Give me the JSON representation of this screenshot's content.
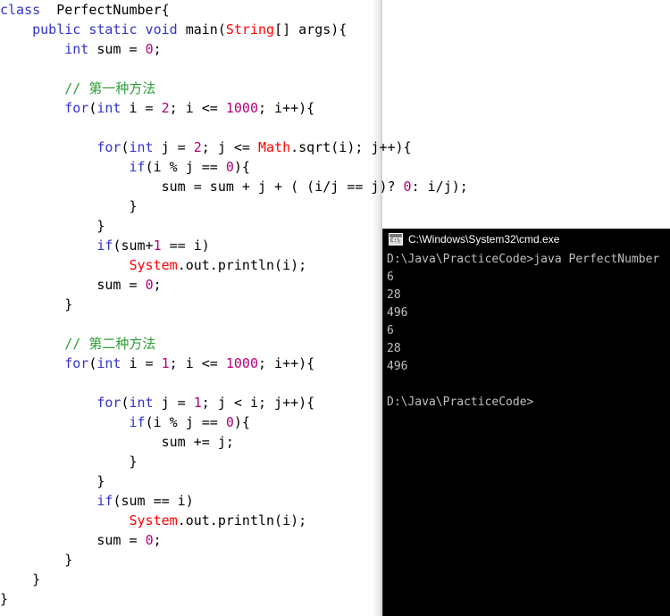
{
  "editor": {
    "name": "java-source-editor",
    "language": "Java",
    "colors": {
      "background": "#ffffff",
      "keyword": "#3333cc",
      "type": "#ff0000",
      "number": "#b3007a",
      "comment": "#2e9e37",
      "plain": "#000000"
    },
    "lines": [
      [
        {
          "t": "class ",
          "c": "kw"
        },
        {
          "t": " PerfectNumber{",
          "c": "pln"
        }
      ],
      [
        {
          "t": "    ",
          "c": "pln"
        },
        {
          "t": "public static void ",
          "c": "kw"
        },
        {
          "t": "main(",
          "c": "pln"
        },
        {
          "t": "String",
          "c": "type"
        },
        {
          "t": "[] args){",
          "c": "pln"
        }
      ],
      [
        {
          "t": "        ",
          "c": "pln"
        },
        {
          "t": "int ",
          "c": "kw"
        },
        {
          "t": "sum = ",
          "c": "pln"
        },
        {
          "t": "0",
          "c": "num"
        },
        {
          "t": ";",
          "c": "pln"
        }
      ],
      [],
      [
        {
          "t": "        ",
          "c": "pln"
        },
        {
          "t": "// 第一种方法",
          "c": "cmt"
        }
      ],
      [
        {
          "t": "        ",
          "c": "pln"
        },
        {
          "t": "for",
          "c": "kw"
        },
        {
          "t": "(",
          "c": "pln"
        },
        {
          "t": "int ",
          "c": "kw"
        },
        {
          "t": "i = ",
          "c": "pln"
        },
        {
          "t": "2",
          "c": "num"
        },
        {
          "t": "; i <= ",
          "c": "pln"
        },
        {
          "t": "1000",
          "c": "num"
        },
        {
          "t": "; i++){",
          "c": "pln"
        }
      ],
      [],
      [
        {
          "t": "            ",
          "c": "pln"
        },
        {
          "t": "for",
          "c": "kw"
        },
        {
          "t": "(",
          "c": "pln"
        },
        {
          "t": "int ",
          "c": "kw"
        },
        {
          "t": "j = ",
          "c": "pln"
        },
        {
          "t": "2",
          "c": "num"
        },
        {
          "t": "; j <= ",
          "c": "pln"
        },
        {
          "t": "Math",
          "c": "type"
        },
        {
          "t": ".sqrt(i); j++){",
          "c": "pln"
        }
      ],
      [
        {
          "t": "                ",
          "c": "pln"
        },
        {
          "t": "if",
          "c": "kw"
        },
        {
          "t": "(i % j == ",
          "c": "pln"
        },
        {
          "t": "0",
          "c": "num"
        },
        {
          "t": "){",
          "c": "pln"
        }
      ],
      [
        {
          "t": "                    sum = sum + j + ( (i/j == j)? ",
          "c": "pln"
        },
        {
          "t": "0",
          "c": "num"
        },
        {
          "t": ": i/j);",
          "c": "pln"
        }
      ],
      [
        {
          "t": "                }",
          "c": "pln"
        }
      ],
      [
        {
          "t": "            }",
          "c": "pln"
        }
      ],
      [
        {
          "t": "            ",
          "c": "pln"
        },
        {
          "t": "if",
          "c": "kw"
        },
        {
          "t": "(sum+",
          "c": "pln"
        },
        {
          "t": "1",
          "c": "num"
        },
        {
          "t": " == i)",
          "c": "pln"
        }
      ],
      [
        {
          "t": "                ",
          "c": "pln"
        },
        {
          "t": "System",
          "c": "type"
        },
        {
          "t": ".out.println(i);",
          "c": "pln"
        }
      ],
      [
        {
          "t": "            sum = ",
          "c": "pln"
        },
        {
          "t": "0",
          "c": "num"
        },
        {
          "t": ";",
          "c": "pln"
        }
      ],
      [
        {
          "t": "        }",
          "c": "pln"
        }
      ],
      [],
      [
        {
          "t": "        ",
          "c": "pln"
        },
        {
          "t": "// 第二种方法",
          "c": "cmt"
        }
      ],
      [
        {
          "t": "        ",
          "c": "pln"
        },
        {
          "t": "for",
          "c": "kw"
        },
        {
          "t": "(",
          "c": "pln"
        },
        {
          "t": "int ",
          "c": "kw"
        },
        {
          "t": "i = ",
          "c": "pln"
        },
        {
          "t": "1",
          "c": "num"
        },
        {
          "t": "; i <= ",
          "c": "pln"
        },
        {
          "t": "1000",
          "c": "num"
        },
        {
          "t": "; i++){",
          "c": "pln"
        }
      ],
      [],
      [
        {
          "t": "            ",
          "c": "pln"
        },
        {
          "t": "for",
          "c": "kw"
        },
        {
          "t": "(",
          "c": "pln"
        },
        {
          "t": "int ",
          "c": "kw"
        },
        {
          "t": "j = ",
          "c": "pln"
        },
        {
          "t": "1",
          "c": "num"
        },
        {
          "t": "; j < i; j++){",
          "c": "pln"
        }
      ],
      [
        {
          "t": "                ",
          "c": "pln"
        },
        {
          "t": "if",
          "c": "kw"
        },
        {
          "t": "(i % j == ",
          "c": "pln"
        },
        {
          "t": "0",
          "c": "num"
        },
        {
          "t": "){",
          "c": "pln"
        }
      ],
      [
        {
          "t": "                    sum += j;",
          "c": "pln"
        }
      ],
      [
        {
          "t": "                }",
          "c": "pln"
        }
      ],
      [
        {
          "t": "            }",
          "c": "pln"
        }
      ],
      [
        {
          "t": "            ",
          "c": "pln"
        },
        {
          "t": "if",
          "c": "kw"
        },
        {
          "t": "(sum == i)",
          "c": "pln"
        }
      ],
      [
        {
          "t": "                ",
          "c": "pln"
        },
        {
          "t": "System",
          "c": "type"
        },
        {
          "t": ".out.println(i);",
          "c": "pln"
        }
      ],
      [
        {
          "t": "            sum = ",
          "c": "pln"
        },
        {
          "t": "0",
          "c": "num"
        },
        {
          "t": ";",
          "c": "pln"
        }
      ],
      [
        {
          "t": "        }",
          "c": "pln"
        }
      ],
      [
        {
          "t": "    }",
          "c": "pln"
        }
      ],
      [
        {
          "t": "}",
          "c": "pln"
        }
      ]
    ]
  },
  "console": {
    "title": "C:\\Windows\\System32\\cmd.exe",
    "icon": "cmd-console-icon",
    "colors": {
      "background": "#000000",
      "text": "#c0c0c0"
    },
    "lines": [
      "D:\\Java\\PracticeCode>java PerfectNumber",
      "6",
      "28",
      "496",
      "6",
      "28",
      "496",
      "",
      "D:\\Java\\PracticeCode>"
    ]
  }
}
